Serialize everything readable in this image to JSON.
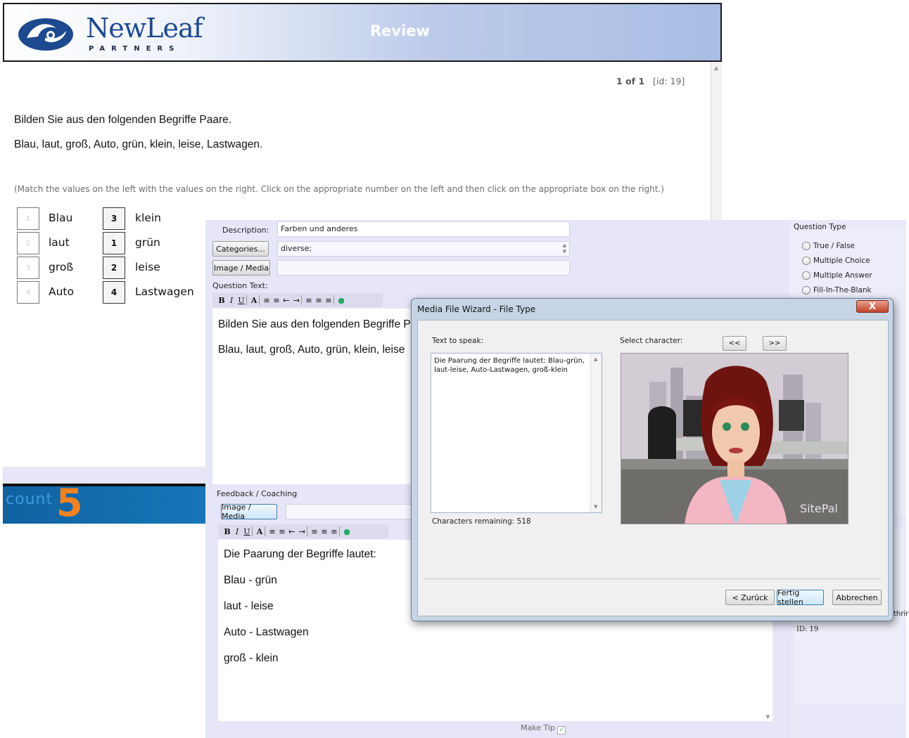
{
  "review": {
    "logo_word": "NewLeaf",
    "logo_sub": "PARTNERS",
    "header_title": "Review",
    "page_position": "1 of 1",
    "page_id": "[id: 19]",
    "question_line1": "Bilden Sie aus den folgenden Begriffe Paare.",
    "question_line2": "Blau, laut, groß, Auto, grün, klein, leise, Lastwagen.",
    "instructions": "(Match the values on the left with the values on the right. Click on the appropriate number on the left and then click on the appropriate box on the right.)",
    "left_items": [
      {
        "num": "1",
        "label": "Blau"
      },
      {
        "num": "2",
        "label": "laut"
      },
      {
        "num": "3",
        "label": "groß"
      },
      {
        "num": "4",
        "label": "Auto"
      }
    ],
    "right_items": [
      {
        "num": "3",
        "label": "klein"
      },
      {
        "num": "1",
        "label": "grün"
      },
      {
        "num": "2",
        "label": "leise"
      },
      {
        "num": "4",
        "label": "Lastwagen"
      }
    ],
    "footer_brand_word": "count",
    "footer_brand_number": "5"
  },
  "editor": {
    "description_label": "Description:",
    "description_value": "Farben und anderes",
    "categories_button": "Categories...",
    "categories_value": "diverse;",
    "image_media_button": "Image / Media",
    "question_text_label": "Question Text:",
    "question_text_line1": "Bilden Sie aus den folgenden Begriffe P",
    "question_text_line2": "Blau, laut, groß, Auto, grün, klein, leise",
    "feedback_label": "Feedback / Coaching",
    "feedback_image_button": "Image / Media",
    "feedback_lines": [
      "Die Paarung der Begriffe lautet:",
      "Blau - grün",
      "laut - leise",
      "Auto - Lastwagen",
      "groß - klein"
    ],
    "make_tip_label": "Make Tip",
    "question_type_label": "Question Type",
    "question_types": [
      "True / False",
      "Multiple Choice",
      "Multiple Answer",
      "Fill-In-The-Blank"
    ],
    "partial_text": "thrir",
    "id_label": "ID:",
    "id_value": "19"
  },
  "dialog": {
    "title": "Media File Wizard - File Type",
    "close_symbol": "X",
    "text_to_speak_label": "Text to speak:",
    "text_to_speak_value": "Die Paarung der Begriffe lautet: Blau-grün, laut-leise, Auto-Lastwagen, groß-klein",
    "characters_remaining": "Characters remaining: 518",
    "select_character_label": "Select character:",
    "prev_button": "<<",
    "next_button": ">>",
    "avatar_watermark": "SitePal",
    "back_button": "< Zurück",
    "finish_button": "Fertig stellen",
    "cancel_button": "Abbrechen"
  },
  "toolbar_glyphs": [
    "B",
    "I",
    "U",
    "A",
    "≡",
    "≡",
    "⇤",
    "⇥",
    "≡",
    "≡",
    "≡",
    "●"
  ]
}
